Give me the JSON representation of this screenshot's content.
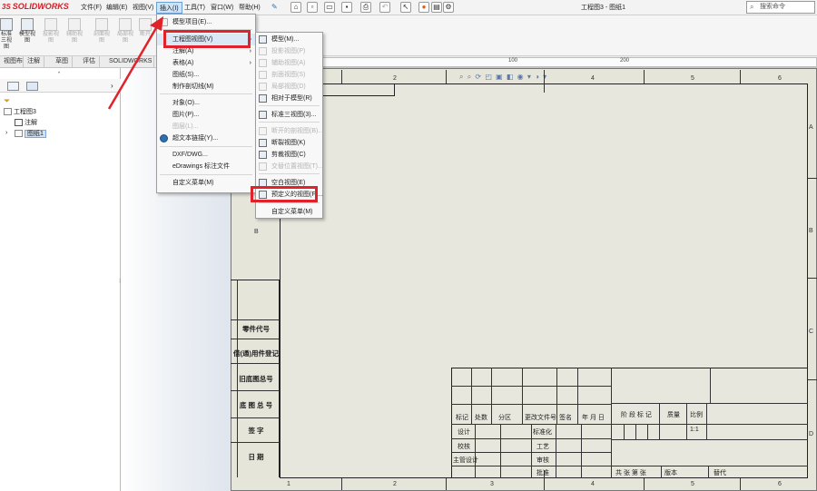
{
  "app": {
    "logo_text": "SOLIDWORKS",
    "logo_mark": "3S"
  },
  "menubar": [
    "文件(F)",
    "编辑(E)",
    "视图(V)",
    "插入(I)",
    "工具(T)",
    "窗口(W)",
    "帮助(H)"
  ],
  "window_title": "工程图3 - 图纸1",
  "search": {
    "placeholder": "搜索命令"
  },
  "command_manager": [
    {
      "label": "模型视图",
      "enabled": true
    },
    {
      "label": "投影视图",
      "enabled": false
    },
    {
      "label": "辅助视图",
      "enabled": false
    },
    {
      "label": "剖面视图",
      "enabled": false
    },
    {
      "label": "局部视图",
      "enabled": false
    },
    {
      "label": "断开",
      "enabled": false
    }
  ],
  "command_manager_partial": "标准三视图",
  "tabs": [
    "视图布局",
    "注解",
    "草图",
    "评估",
    "SOLIDWORKS 插件"
  ],
  "ruler_labels": [
    "100",
    "200"
  ],
  "feature_tree": {
    "root": "工程图3",
    "items": [
      {
        "label": "注解"
      },
      {
        "label": "图纸1",
        "selected": true
      }
    ]
  },
  "insert_menu": {
    "items": [
      {
        "label": "模型项目(E)...",
        "has_submenu": false
      },
      {
        "label": "工程图视图(V)",
        "has_submenu": true,
        "highlighted": true
      },
      {
        "label": "注解(A)",
        "has_submenu": true
      },
      {
        "label": "表格(A)",
        "has_submenu": true
      },
      {
        "label": "图纸(S)...",
        "has_submenu": false
      },
      {
        "label": "制作剖切线(M)",
        "has_submenu": false
      },
      {
        "label": "对象(O)...",
        "has_submenu": false
      },
      {
        "label": "图片(P)...",
        "has_submenu": false
      },
      {
        "label": "图层(L)...",
        "has_submenu": false,
        "enabled": false
      },
      {
        "label": "超文本链接(Y)...",
        "has_submenu": false
      },
      {
        "label": "DXF/DWG...",
        "has_submenu": false
      },
      {
        "label": "eDrawings 标注文件",
        "has_submenu": false
      },
      {
        "label": "自定义菜单(M)",
        "has_submenu": false
      }
    ]
  },
  "drawing_view_submenu": {
    "items": [
      {
        "label": "模型(M)...",
        "enabled": true
      },
      {
        "label": "投影视图(P)",
        "enabled": false
      },
      {
        "label": "辅助视图(A)",
        "enabled": false
      },
      {
        "label": "剖面视图(S)",
        "enabled": false
      },
      {
        "label": "局部视图(D)",
        "enabled": false
      },
      {
        "label": "相对于模型(R)",
        "enabled": true
      },
      {
        "label": "标准三视图(3)...",
        "enabled": true
      },
      {
        "label": "断开的剖视图(B)...",
        "enabled": false
      },
      {
        "label": "断裂视图(K)",
        "enabled": true
      },
      {
        "label": "剪裁视图(C)",
        "enabled": true
      },
      {
        "label": "交替位置视图(T)...",
        "enabled": false
      },
      {
        "label": "空白视图(E)",
        "enabled": true
      },
      {
        "label": "预定义的视图(F)...",
        "enabled": true,
        "highlighted": true
      },
      {
        "label": "自定义菜单(M)",
        "enabled": true
      }
    ]
  },
  "sheet": {
    "zones_top": [
      "1",
      "2",
      "3",
      "4",
      "5",
      "6"
    ],
    "zones_side": [
      "A",
      "B",
      "C",
      "D"
    ],
    "side_cells": [
      "零件代号",
      "借(通)用件登记",
      "旧底图总号",
      "底 图 总 号",
      "签   字",
      "日   期"
    ],
    "title_block": {
      "row_header": [
        "标记",
        "处数",
        "分区",
        "更改文件号",
        "签名",
        "年 月 日"
      ],
      "stage_header": [
        "阶 段 标 记",
        "质量",
        "比例"
      ],
      "scale": "1:1",
      "left_labels": [
        "设计",
        "校核",
        "主管设计"
      ],
      "mid_labels": [
        "标准化",
        "工艺",
        "审核",
        "批准"
      ],
      "sheets": "共  张  第  张",
      "version": "版本",
      "replace": "替代"
    }
  },
  "colors": {
    "highlight_red": "#e0232b",
    "menu_highlight": "#dbe8f6",
    "sheet_bg": "#e5e5da"
  }
}
